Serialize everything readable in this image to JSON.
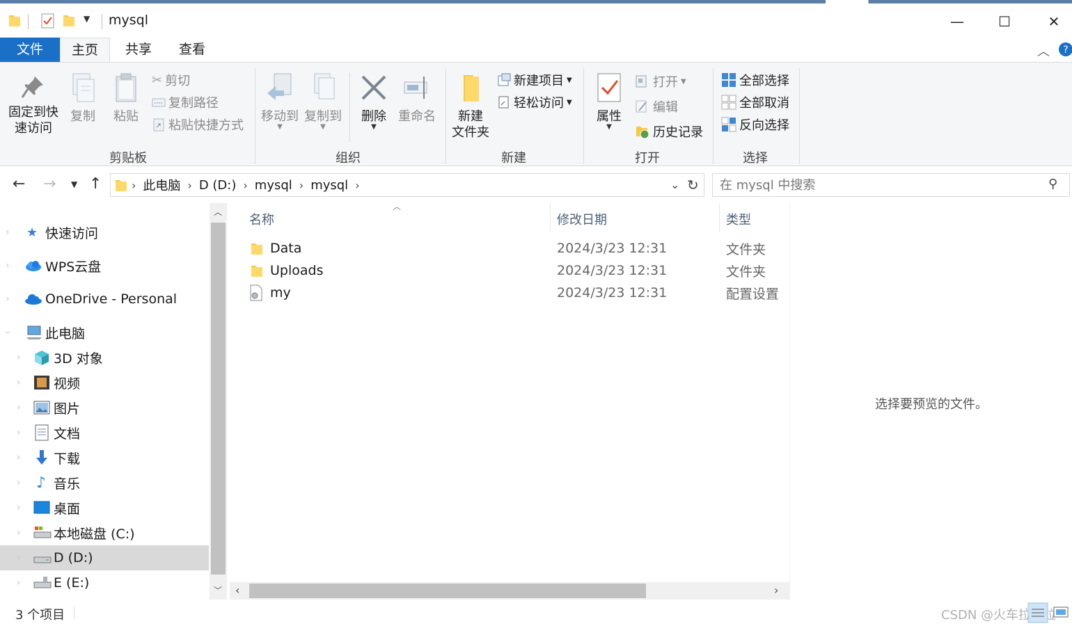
{
  "window": {
    "title": "mysql",
    "minimize": "—",
    "maximize": "☐",
    "close": "✕"
  },
  "tabs": [
    {
      "label": "文件"
    },
    {
      "label": "主页"
    },
    {
      "label": "共享"
    },
    {
      "label": "查看"
    }
  ],
  "ribbon": {
    "clipboard": {
      "group_label": "剪贴板",
      "pin_line1": "固定到快",
      "pin_line2": "速访问",
      "copy": "复制",
      "paste": "粘贴",
      "cut": "剪切",
      "copy_path": "复制路径",
      "paste_shortcut": "粘贴快捷方式"
    },
    "organize": {
      "group_label": "组织",
      "move_to": "移动到",
      "copy_to": "复制到",
      "delete": "删除",
      "rename": "重命名"
    },
    "new": {
      "group_label": "新建",
      "new_folder_line1": "新建",
      "new_folder_line2": "文件夹",
      "new_item": "新建项目",
      "easy_access": "轻松访问"
    },
    "open": {
      "group_label": "打开",
      "properties": "属性",
      "open": "打开",
      "edit": "编辑",
      "history": "历史记录"
    },
    "select": {
      "group_label": "选择",
      "select_all": "全部选择",
      "select_none": "全部取消",
      "invert": "反向选择"
    }
  },
  "address": {
    "crumbs": [
      "此电脑",
      "D (D:)",
      "mysql",
      "mysql"
    ],
    "search_placeholder": "在 mysql 中搜索"
  },
  "nav": {
    "items": [
      {
        "label": "快速访问",
        "icon": "star-icon"
      },
      {
        "label": "WPS云盘",
        "icon": "cloud-icon"
      },
      {
        "label": "OneDrive - Personal",
        "icon": "onedrive-icon"
      },
      {
        "label": "此电脑",
        "icon": "computer-icon"
      },
      {
        "label": "3D 对象",
        "icon": "cube-icon"
      },
      {
        "label": "视频",
        "icon": "video-icon"
      },
      {
        "label": "图片",
        "icon": "picture-icon"
      },
      {
        "label": "文档",
        "icon": "document-icon"
      },
      {
        "label": "下载",
        "icon": "download-icon"
      },
      {
        "label": "音乐",
        "icon": "music-icon"
      },
      {
        "label": "桌面",
        "icon": "desktop-icon"
      },
      {
        "label": "本地磁盘 (C:)",
        "icon": "drive-icon"
      },
      {
        "label": "D (D:)",
        "icon": "drive-icon"
      },
      {
        "label": "E (E:)",
        "icon": "drive-icon"
      }
    ]
  },
  "filelist": {
    "columns": {
      "name": "名称",
      "date": "修改日期",
      "type": "类型"
    },
    "rows": [
      {
        "name": "Data",
        "date": "2024/3/23 12:31",
        "type": "文件夹",
        "icon": "folder-icon"
      },
      {
        "name": "Uploads",
        "date": "2024/3/23 12:31",
        "type": "文件夹",
        "icon": "folder-icon"
      },
      {
        "name": "my",
        "date": "2024/3/23 12:31",
        "type": "配置设置",
        "icon": "config-file-icon"
      }
    ]
  },
  "preview": {
    "text": "选择要预览的文件。"
  },
  "status": {
    "count": "3 个项目"
  },
  "watermark": "CSDN @火车拉拖拉"
}
